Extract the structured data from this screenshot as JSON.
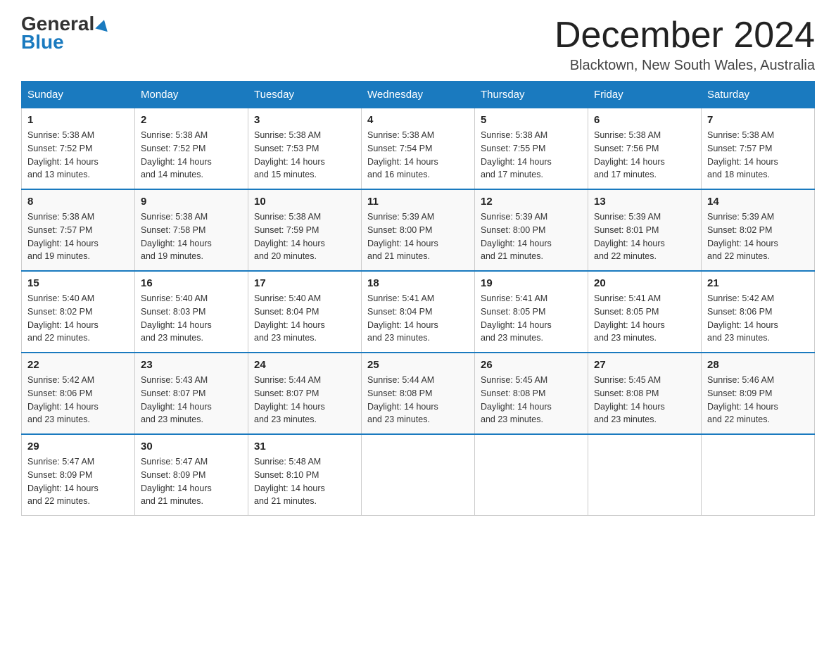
{
  "header": {
    "logo_general": "General",
    "logo_blue": "Blue",
    "main_title": "December 2024",
    "subtitle": "Blacktown, New South Wales, Australia"
  },
  "days_of_week": [
    "Sunday",
    "Monday",
    "Tuesday",
    "Wednesday",
    "Thursday",
    "Friday",
    "Saturday"
  ],
  "weeks": [
    [
      {
        "day": "1",
        "sunrise": "5:38 AM",
        "sunset": "7:52 PM",
        "daylight": "14 hours and 13 minutes."
      },
      {
        "day": "2",
        "sunrise": "5:38 AM",
        "sunset": "7:52 PM",
        "daylight": "14 hours and 14 minutes."
      },
      {
        "day": "3",
        "sunrise": "5:38 AM",
        "sunset": "7:53 PM",
        "daylight": "14 hours and 15 minutes."
      },
      {
        "day": "4",
        "sunrise": "5:38 AM",
        "sunset": "7:54 PM",
        "daylight": "14 hours and 16 minutes."
      },
      {
        "day": "5",
        "sunrise": "5:38 AM",
        "sunset": "7:55 PM",
        "daylight": "14 hours and 17 minutes."
      },
      {
        "day": "6",
        "sunrise": "5:38 AM",
        "sunset": "7:56 PM",
        "daylight": "14 hours and 17 minutes."
      },
      {
        "day": "7",
        "sunrise": "5:38 AM",
        "sunset": "7:57 PM",
        "daylight": "14 hours and 18 minutes."
      }
    ],
    [
      {
        "day": "8",
        "sunrise": "5:38 AM",
        "sunset": "7:57 PM",
        "daylight": "14 hours and 19 minutes."
      },
      {
        "day": "9",
        "sunrise": "5:38 AM",
        "sunset": "7:58 PM",
        "daylight": "14 hours and 19 minutes."
      },
      {
        "day": "10",
        "sunrise": "5:38 AM",
        "sunset": "7:59 PM",
        "daylight": "14 hours and 20 minutes."
      },
      {
        "day": "11",
        "sunrise": "5:39 AM",
        "sunset": "8:00 PM",
        "daylight": "14 hours and 21 minutes."
      },
      {
        "day": "12",
        "sunrise": "5:39 AM",
        "sunset": "8:00 PM",
        "daylight": "14 hours and 21 minutes."
      },
      {
        "day": "13",
        "sunrise": "5:39 AM",
        "sunset": "8:01 PM",
        "daylight": "14 hours and 22 minutes."
      },
      {
        "day": "14",
        "sunrise": "5:39 AM",
        "sunset": "8:02 PM",
        "daylight": "14 hours and 22 minutes."
      }
    ],
    [
      {
        "day": "15",
        "sunrise": "5:40 AM",
        "sunset": "8:02 PM",
        "daylight": "14 hours and 22 minutes."
      },
      {
        "day": "16",
        "sunrise": "5:40 AM",
        "sunset": "8:03 PM",
        "daylight": "14 hours and 23 minutes."
      },
      {
        "day": "17",
        "sunrise": "5:40 AM",
        "sunset": "8:04 PM",
        "daylight": "14 hours and 23 minutes."
      },
      {
        "day": "18",
        "sunrise": "5:41 AM",
        "sunset": "8:04 PM",
        "daylight": "14 hours and 23 minutes."
      },
      {
        "day": "19",
        "sunrise": "5:41 AM",
        "sunset": "8:05 PM",
        "daylight": "14 hours and 23 minutes."
      },
      {
        "day": "20",
        "sunrise": "5:41 AM",
        "sunset": "8:05 PM",
        "daylight": "14 hours and 23 minutes."
      },
      {
        "day": "21",
        "sunrise": "5:42 AM",
        "sunset": "8:06 PM",
        "daylight": "14 hours and 23 minutes."
      }
    ],
    [
      {
        "day": "22",
        "sunrise": "5:42 AM",
        "sunset": "8:06 PM",
        "daylight": "14 hours and 23 minutes."
      },
      {
        "day": "23",
        "sunrise": "5:43 AM",
        "sunset": "8:07 PM",
        "daylight": "14 hours and 23 minutes."
      },
      {
        "day": "24",
        "sunrise": "5:44 AM",
        "sunset": "8:07 PM",
        "daylight": "14 hours and 23 minutes."
      },
      {
        "day": "25",
        "sunrise": "5:44 AM",
        "sunset": "8:08 PM",
        "daylight": "14 hours and 23 minutes."
      },
      {
        "day": "26",
        "sunrise": "5:45 AM",
        "sunset": "8:08 PM",
        "daylight": "14 hours and 23 minutes."
      },
      {
        "day": "27",
        "sunrise": "5:45 AM",
        "sunset": "8:08 PM",
        "daylight": "14 hours and 23 minutes."
      },
      {
        "day": "28",
        "sunrise": "5:46 AM",
        "sunset": "8:09 PM",
        "daylight": "14 hours and 22 minutes."
      }
    ],
    [
      {
        "day": "29",
        "sunrise": "5:47 AM",
        "sunset": "8:09 PM",
        "daylight": "14 hours and 22 minutes."
      },
      {
        "day": "30",
        "sunrise": "5:47 AM",
        "sunset": "8:09 PM",
        "daylight": "14 hours and 21 minutes."
      },
      {
        "day": "31",
        "sunrise": "5:48 AM",
        "sunset": "8:10 PM",
        "daylight": "14 hours and 21 minutes."
      },
      null,
      null,
      null,
      null
    ]
  ],
  "labels": {
    "sunrise": "Sunrise:",
    "sunset": "Sunset:",
    "daylight": "Daylight:"
  }
}
